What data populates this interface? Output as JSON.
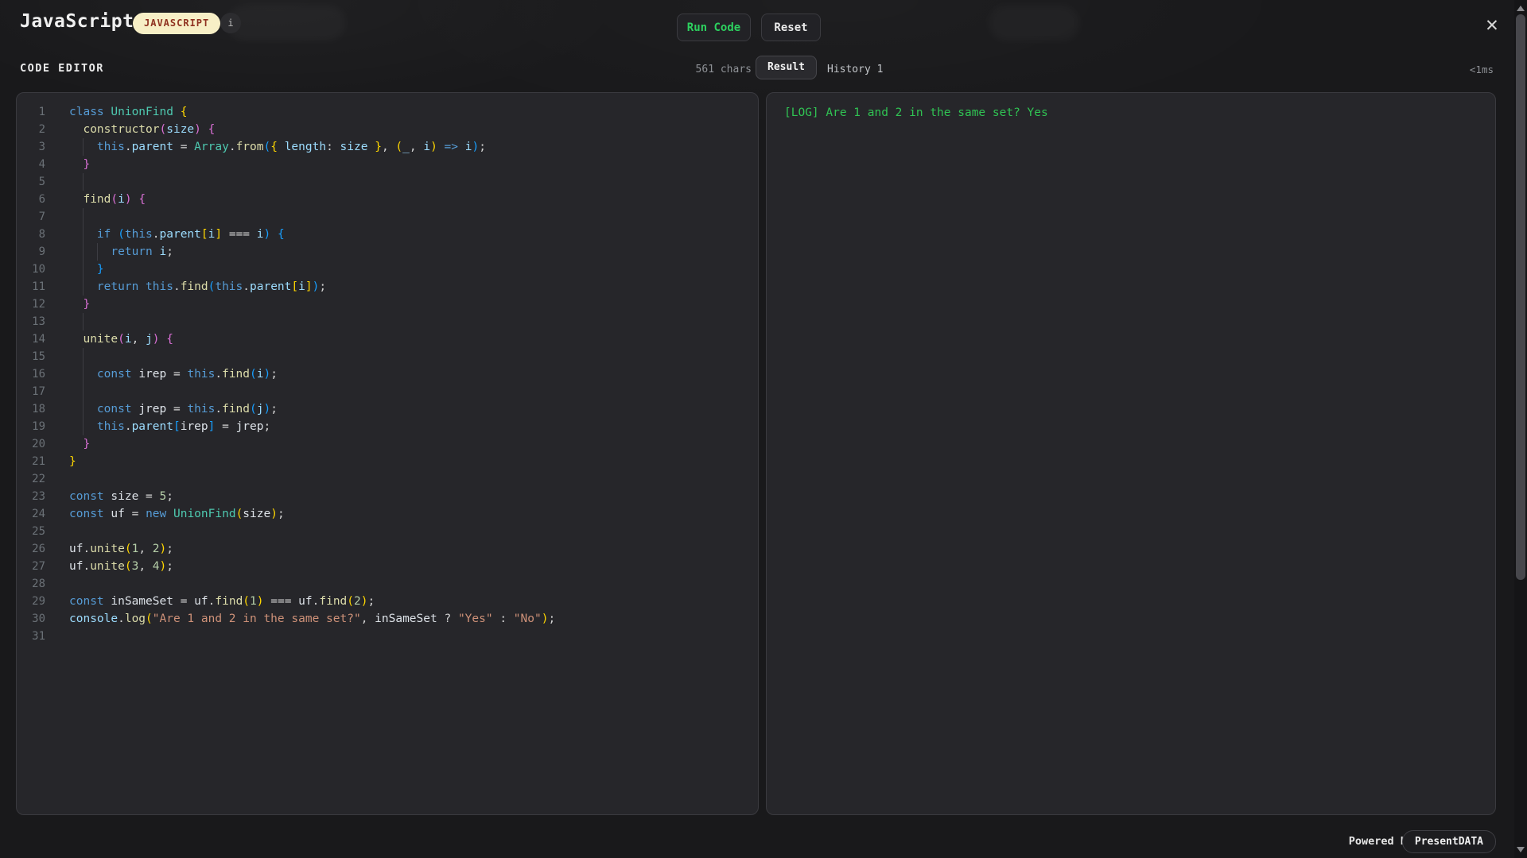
{
  "header": {
    "title": "JavaScript",
    "language_badge": "JAVASCRIPT",
    "info_icon": "i",
    "run_button": "Run Code",
    "reset_button": "Reset",
    "close_icon": "✕"
  },
  "toolbar": {
    "editor_label": "CODE EDITOR",
    "char_count": "561 chars",
    "tabs": [
      {
        "label": "Result",
        "active": true
      },
      {
        "label": "History 1",
        "active": false
      }
    ],
    "exec_time": "<1ms"
  },
  "editor": {
    "lines": [
      {
        "num": "1",
        "guides": [],
        "code": [
          [
            "class ",
            "kw"
          ],
          [
            "UnionFind ",
            "cls"
          ],
          [
            "{",
            "b1"
          ]
        ]
      },
      {
        "num": "2",
        "guides": [],
        "code": [
          [
            "  ",
            "p"
          ],
          [
            "constructor",
            "fn"
          ],
          [
            "(",
            "b2"
          ],
          [
            "size",
            "var"
          ],
          [
            ")",
            "b2"
          ],
          [
            " ",
            "p"
          ],
          [
            "{",
            "b2"
          ]
        ]
      },
      {
        "num": "3",
        "guides": [
          2
        ],
        "code": [
          [
            "    ",
            "p"
          ],
          [
            "this",
            "kw"
          ],
          [
            ".",
            "p"
          ],
          [
            "parent",
            "var"
          ],
          [
            " = ",
            "p"
          ],
          [
            "Array",
            "cls"
          ],
          [
            ".",
            "p"
          ],
          [
            "from",
            "fn"
          ],
          [
            "(",
            "b3"
          ],
          [
            "{",
            "b1"
          ],
          [
            " ",
            "p"
          ],
          [
            "length",
            "var"
          ],
          [
            ": ",
            "p"
          ],
          [
            "size",
            "var"
          ],
          [
            " ",
            "p"
          ],
          [
            "}",
            "b1"
          ],
          [
            ", ",
            "p"
          ],
          [
            "(",
            "b1"
          ],
          [
            "_",
            "var"
          ],
          [
            ", ",
            "p"
          ],
          [
            "i",
            "var"
          ],
          [
            ")",
            "b1"
          ],
          [
            " ",
            "p"
          ],
          [
            "=>",
            "kw"
          ],
          [
            " ",
            "p"
          ],
          [
            "i",
            "var"
          ],
          [
            ")",
            "b3"
          ],
          [
            ";",
            "p"
          ]
        ]
      },
      {
        "num": "4",
        "guides": [],
        "code": [
          [
            "  ",
            "p"
          ],
          [
            "}",
            "b2"
          ]
        ]
      },
      {
        "num": "5",
        "guides": [
          2
        ],
        "code": []
      },
      {
        "num": "6",
        "guides": [],
        "code": [
          [
            "  ",
            "p"
          ],
          [
            "find",
            "fn"
          ],
          [
            "(",
            "b2"
          ],
          [
            "i",
            "var"
          ],
          [
            ")",
            "b2"
          ],
          [
            " ",
            "p"
          ],
          [
            "{",
            "b2"
          ]
        ]
      },
      {
        "num": "7",
        "guides": [
          2
        ],
        "code": []
      },
      {
        "num": "8",
        "guides": [
          2
        ],
        "code": [
          [
            "    ",
            "p"
          ],
          [
            "if ",
            "kw"
          ],
          [
            "(",
            "b3"
          ],
          [
            "this",
            "kw"
          ],
          [
            ".",
            "p"
          ],
          [
            "parent",
            "var"
          ],
          [
            "[",
            "b1"
          ],
          [
            "i",
            "var"
          ],
          [
            "]",
            "b1"
          ],
          [
            " === ",
            "p"
          ],
          [
            "i",
            "var"
          ],
          [
            ")",
            "b3"
          ],
          [
            " ",
            "p"
          ],
          [
            "{",
            "b3"
          ]
        ]
      },
      {
        "num": "9",
        "guides": [
          2,
          4
        ],
        "code": [
          [
            "      ",
            "p"
          ],
          [
            "return ",
            "kw"
          ],
          [
            "i",
            "var"
          ],
          [
            ";",
            "p"
          ]
        ]
      },
      {
        "num": "10",
        "guides": [
          2
        ],
        "code": [
          [
            "    ",
            "p"
          ],
          [
            "}",
            "b3"
          ]
        ]
      },
      {
        "num": "11",
        "guides": [
          2
        ],
        "code": [
          [
            "    ",
            "p"
          ],
          [
            "return ",
            "kw"
          ],
          [
            "this",
            "kw"
          ],
          [
            ".",
            "p"
          ],
          [
            "find",
            "fn"
          ],
          [
            "(",
            "b3"
          ],
          [
            "this",
            "kw"
          ],
          [
            ".",
            "p"
          ],
          [
            "parent",
            "var"
          ],
          [
            "[",
            "b1"
          ],
          [
            "i",
            "var"
          ],
          [
            "]",
            "b1"
          ],
          [
            ")",
            "b3"
          ],
          [
            ";",
            "p"
          ]
        ]
      },
      {
        "num": "12",
        "guides": [],
        "code": [
          [
            "  ",
            "p"
          ],
          [
            "}",
            "b2"
          ]
        ]
      },
      {
        "num": "13",
        "guides": [
          2
        ],
        "code": []
      },
      {
        "num": "14",
        "guides": [],
        "code": [
          [
            "  ",
            "p"
          ],
          [
            "unite",
            "fn"
          ],
          [
            "(",
            "b2"
          ],
          [
            "i",
            "var"
          ],
          [
            ", ",
            "p"
          ],
          [
            "j",
            "var"
          ],
          [
            ")",
            "b2"
          ],
          [
            " ",
            "p"
          ],
          [
            "{",
            "b2"
          ]
        ]
      },
      {
        "num": "15",
        "guides": [
          2
        ],
        "code": []
      },
      {
        "num": "16",
        "guides": [
          2
        ],
        "code": [
          [
            "    ",
            "p"
          ],
          [
            "const ",
            "kw"
          ],
          [
            "irep",
            "id"
          ],
          [
            " = ",
            "p"
          ],
          [
            "this",
            "kw"
          ],
          [
            ".",
            "p"
          ],
          [
            "find",
            "fn"
          ],
          [
            "(",
            "b3"
          ],
          [
            "i",
            "var"
          ],
          [
            ")",
            "b3"
          ],
          [
            ";",
            "p"
          ]
        ]
      },
      {
        "num": "17",
        "guides": [
          2
        ],
        "code": []
      },
      {
        "num": "18",
        "guides": [
          2
        ],
        "code": [
          [
            "    ",
            "p"
          ],
          [
            "const ",
            "kw"
          ],
          [
            "jrep",
            "id"
          ],
          [
            " = ",
            "p"
          ],
          [
            "this",
            "kw"
          ],
          [
            ".",
            "p"
          ],
          [
            "find",
            "fn"
          ],
          [
            "(",
            "b3"
          ],
          [
            "j",
            "var"
          ],
          [
            ")",
            "b3"
          ],
          [
            ";",
            "p"
          ]
        ]
      },
      {
        "num": "19",
        "guides": [
          2
        ],
        "code": [
          [
            "    ",
            "p"
          ],
          [
            "this",
            "kw"
          ],
          [
            ".",
            "p"
          ],
          [
            "parent",
            "var"
          ],
          [
            "[",
            "b3"
          ],
          [
            "irep",
            "id"
          ],
          [
            "]",
            "b3"
          ],
          [
            " = ",
            "p"
          ],
          [
            "jrep",
            "id"
          ],
          [
            ";",
            "p"
          ]
        ]
      },
      {
        "num": "20",
        "guides": [],
        "code": [
          [
            "  ",
            "p"
          ],
          [
            "}",
            "b2"
          ]
        ]
      },
      {
        "num": "21",
        "guides": [],
        "code": [
          [
            "}",
            "b1"
          ]
        ]
      },
      {
        "num": "22",
        "guides": [],
        "code": []
      },
      {
        "num": "23",
        "guides": [],
        "code": [
          [
            "const ",
            "kw"
          ],
          [
            "size",
            "id"
          ],
          [
            " = ",
            "p"
          ],
          [
            "5",
            "num"
          ],
          [
            ";",
            "p"
          ]
        ]
      },
      {
        "num": "24",
        "guides": [],
        "code": [
          [
            "const ",
            "kw"
          ],
          [
            "uf",
            "id"
          ],
          [
            " = ",
            "p"
          ],
          [
            "new ",
            "kw"
          ],
          [
            "UnionFind",
            "cls"
          ],
          [
            "(",
            "b1"
          ],
          [
            "size",
            "id"
          ],
          [
            ")",
            "b1"
          ],
          [
            ";",
            "p"
          ]
        ]
      },
      {
        "num": "25",
        "guides": [],
        "code": []
      },
      {
        "num": "26",
        "guides": [],
        "code": [
          [
            "uf",
            "id"
          ],
          [
            ".",
            "p"
          ],
          [
            "unite",
            "fn"
          ],
          [
            "(",
            "b1"
          ],
          [
            "1",
            "num"
          ],
          [
            ", ",
            "p"
          ],
          [
            "2",
            "num"
          ],
          [
            ")",
            "b1"
          ],
          [
            ";",
            "p"
          ]
        ]
      },
      {
        "num": "27",
        "guides": [],
        "code": [
          [
            "uf",
            "id"
          ],
          [
            ".",
            "p"
          ],
          [
            "unite",
            "fn"
          ],
          [
            "(",
            "b1"
          ],
          [
            "3",
            "num"
          ],
          [
            ", ",
            "p"
          ],
          [
            "4",
            "num"
          ],
          [
            ")",
            "b1"
          ],
          [
            ";",
            "p"
          ]
        ]
      },
      {
        "num": "28",
        "guides": [],
        "code": []
      },
      {
        "num": "29",
        "guides": [],
        "code": [
          [
            "const ",
            "kw"
          ],
          [
            "inSameSet",
            "id"
          ],
          [
            " = ",
            "p"
          ],
          [
            "uf",
            "id"
          ],
          [
            ".",
            "p"
          ],
          [
            "find",
            "fn"
          ],
          [
            "(",
            "b1"
          ],
          [
            "1",
            "num"
          ],
          [
            ")",
            "b1"
          ],
          [
            " === ",
            "p"
          ],
          [
            "uf",
            "id"
          ],
          [
            ".",
            "p"
          ],
          [
            "find",
            "fn"
          ],
          [
            "(",
            "b1"
          ],
          [
            "2",
            "num"
          ],
          [
            ")",
            "b1"
          ],
          [
            ";",
            "p"
          ]
        ]
      },
      {
        "num": "30",
        "guides": [],
        "code": [
          [
            "console",
            "var"
          ],
          [
            ".",
            "p"
          ],
          [
            "log",
            "fn"
          ],
          [
            "(",
            "b1"
          ],
          [
            "\"Are 1 and 2 in the same set?\"",
            "str"
          ],
          [
            ", ",
            "p"
          ],
          [
            "inSameSet",
            "id"
          ],
          [
            " ? ",
            "p"
          ],
          [
            "\"Yes\"",
            "str"
          ],
          [
            " : ",
            "p"
          ],
          [
            "\"No\"",
            "str"
          ],
          [
            ")",
            "b1"
          ],
          [
            ";",
            "p"
          ]
        ]
      },
      {
        "num": "31",
        "guides": [],
        "code": []
      }
    ]
  },
  "console": {
    "entries": [
      {
        "text": "[LOG] Are 1 and 2 in the same set? Yes"
      }
    ]
  },
  "footer": {
    "powered_by": "Powered by",
    "brand": "PresentDATA"
  },
  "colors": {
    "accent_green": "#2dd15f",
    "console_log_green": "#30c353",
    "badge_bg": "#f7efc6",
    "badge_text": "#8f3220",
    "tokens": {
      "kw": "#569cd6",
      "cls": "#4ec9b0",
      "fn": "#dcdcaa",
      "var": "#9cdcfe",
      "id": "#dde2e8",
      "num": "#b5cea8",
      "str": "#ce9178",
      "p": "#d4d4d4",
      "b1": "#ffd700",
      "b2": "#da70d6",
      "b3": "#179fff"
    }
  }
}
